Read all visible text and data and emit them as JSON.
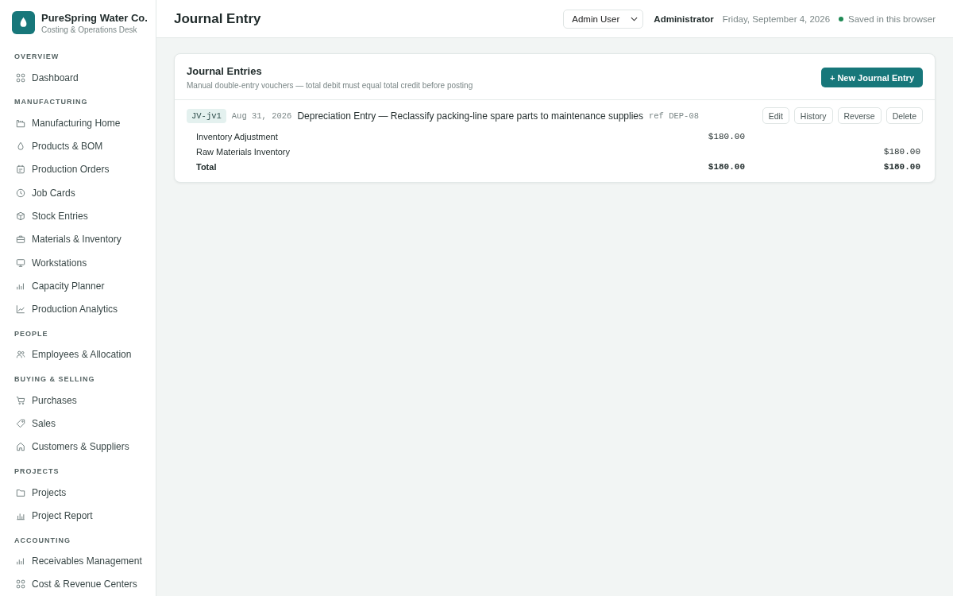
{
  "brand": {
    "name": "PureSpring Water Co.",
    "subtitle": "Costing & Operations Desk"
  },
  "sidebar": {
    "sections": [
      {
        "title": "OVERVIEW",
        "items": [
          {
            "label": "Dashboard"
          }
        ]
      },
      {
        "title": "MANUFACTURING",
        "items": [
          {
            "label": "Manufacturing Home"
          },
          {
            "label": "Products & BOM"
          },
          {
            "label": "Production Orders"
          },
          {
            "label": "Job Cards"
          },
          {
            "label": "Stock Entries"
          },
          {
            "label": "Materials & Inventory"
          },
          {
            "label": "Workstations"
          },
          {
            "label": "Capacity Planner"
          },
          {
            "label": "Production Analytics"
          }
        ]
      },
      {
        "title": "PEOPLE",
        "items": [
          {
            "label": "Employees & Allocation"
          }
        ]
      },
      {
        "title": "BUYING & SELLING",
        "items": [
          {
            "label": "Purchases"
          },
          {
            "label": "Sales"
          },
          {
            "label": "Customers & Suppliers"
          }
        ]
      },
      {
        "title": "PROJECTS",
        "items": [
          {
            "label": "Projects"
          },
          {
            "label": "Project Report"
          }
        ]
      },
      {
        "title": "ACCOUNTING",
        "items": [
          {
            "label": "Receivables Management"
          },
          {
            "label": "Cost & Revenue Centers"
          }
        ]
      }
    ]
  },
  "header": {
    "title": "Journal Entry",
    "user_select": "Admin User",
    "role": "Administrator",
    "date": "Friday, September 4, 2026",
    "save_status": "Saved in this browser"
  },
  "panel": {
    "title": "Journal Entries",
    "subtitle": "Manual double-entry vouchers — total debit must equal total credit before posting",
    "new_button": "+ New Journal Entry",
    "entries": [
      {
        "id": "JV-jv1",
        "date": "Aug 31, 2026",
        "description": "Depreciation Entry — Reclassify packing-line spare parts to maintenance supplies",
        "ref": "ref DEP-08",
        "actions": [
          "Edit",
          "History",
          "Reverse",
          "Delete"
        ],
        "lines": [
          {
            "account": "Inventory Adjustment",
            "debit": "$180.00"
          },
          {
            "account": "Raw Materials Inventory",
            "credit": "$180.00"
          }
        ],
        "total": {
          "label": "Total",
          "debit": "$180.00",
          "credit": "$180.00"
        }
      }
    ]
  }
}
